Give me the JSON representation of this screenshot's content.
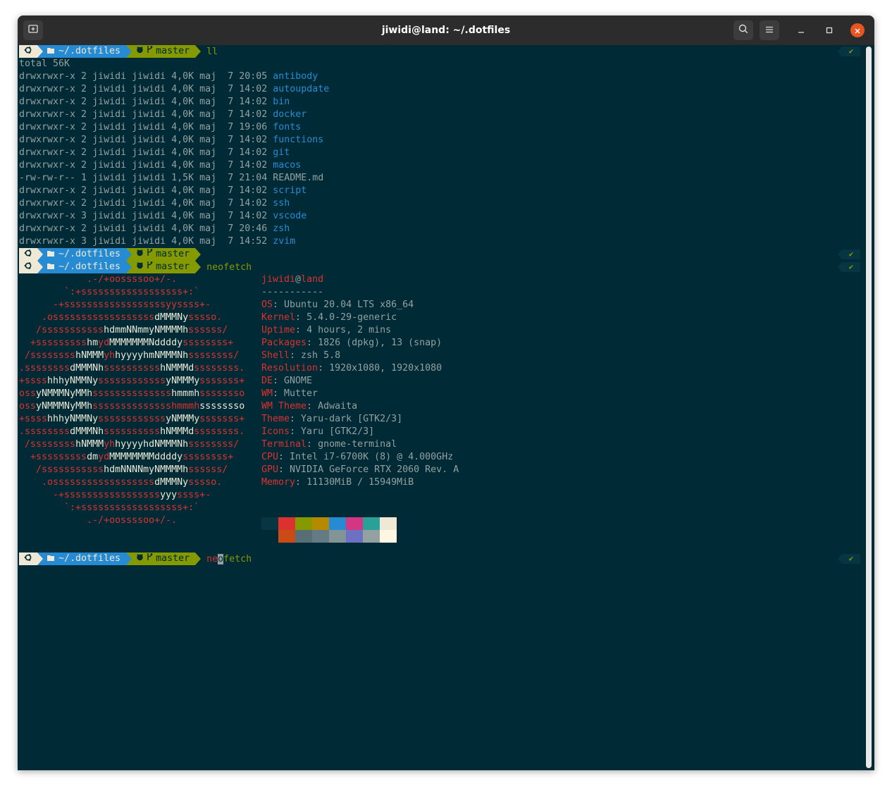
{
  "window": {
    "title": "jiwidi@land: ~/.dotfiles",
    "icons": {
      "new_tab": "new-tab-icon",
      "search": "search-icon",
      "menu": "hamburger-menu-icon",
      "minimize": "minimize-icon",
      "maximize": "maximize-icon",
      "close": "close-icon"
    }
  },
  "prompt": {
    "dir": "~/.dotfiles",
    "branch": "master",
    "status": "✔"
  },
  "commands": {
    "ll": "ll",
    "neofetch": "neofetch",
    "typed_pre": "ne",
    "typed_cursor": "o",
    "typed_post": "fetch"
  },
  "ls": {
    "total": "total 56K",
    "rows": [
      {
        "perm": "drwxrwxr-x 2 jiwidi jiwidi 4,0K maj  7 20:05 ",
        "name": "antibody"
      },
      {
        "perm": "drwxrwxr-x 2 jiwidi jiwidi 4,0K maj  7 14:02 ",
        "name": "autoupdate"
      },
      {
        "perm": "drwxrwxr-x 2 jiwidi jiwidi 4,0K maj  7 14:02 ",
        "name": "bin"
      },
      {
        "perm": "drwxrwxr-x 2 jiwidi jiwidi 4,0K maj  7 14:02 ",
        "name": "docker"
      },
      {
        "perm": "drwxrwxr-x 2 jiwidi jiwidi 4,0K maj  7 19:06 ",
        "name": "fonts"
      },
      {
        "perm": "drwxrwxr-x 2 jiwidi jiwidi 4,0K maj  7 14:02 ",
        "name": "functions"
      },
      {
        "perm": "drwxrwxr-x 2 jiwidi jiwidi 4,0K maj  7 14:02 ",
        "name": "git"
      },
      {
        "perm": "drwxrwxr-x 2 jiwidi jiwidi 4,0K maj  7 14:02 ",
        "name": "macos"
      },
      {
        "perm": "-rw-rw-r-- 1 jiwidi jiwidi 1,5K maj  7 21:04 ",
        "name": "README.md",
        "plain": true
      },
      {
        "perm": "drwxrwxr-x 2 jiwidi jiwidi 4,0K maj  7 14:02 ",
        "name": "script"
      },
      {
        "perm": "drwxrwxr-x 2 jiwidi jiwidi 4,0K maj  7 14:02 ",
        "name": "ssh"
      },
      {
        "perm": "drwxrwxr-x 3 jiwidi jiwidi 4,0K maj  7 14:02 ",
        "name": "vscode"
      },
      {
        "perm": "drwxrwxr-x 2 jiwidi jiwidi 4,0K maj  7 20:46 ",
        "name": "zsh"
      },
      {
        "perm": "drwxrwxr-x 3 jiwidi jiwidi 4,0K maj  7 14:52 ",
        "name": "zvim"
      }
    ]
  },
  "logo": [
    "            .-/+oossssoo+/-.",
    "        `:+ssssssssssssssssss+:`",
    "      -+ssssssssssssssssssyyssss+-",
    "    .ossssssssssssssssss|dMMMNy|sssso.",
    "   /sssssssssss|hdmmNNmmyNMMMMh|ssssss/",
    "  +sssssssss|hm|yd|MMMMMMMNddddy|ssssssss+",
    " /ssssssss|hNMMM|yh|hyyyyhmNMMMNh|ssssssss/",
    ".ssssssss|dMMMNh|ssssssssss|hNMMMd|ssssssss.",
    "+ssss|hhhyNMMNy|ssssssssssss|yNMMMy|sssssss+",
    "oss|yNMMMNyMMh|ssssssssssssss|hmmmh|ssssssso",
    "oss|yNMMMNyMMh|sssssssssssssshmmmh|ssssssso",
    "+ssss|hhhyNMMNy|ssssssssssss|yNMMMy|sssssss+",
    ".ssssssss|dMMMNh|ssssssssss|hNMMMd|ssssssss.",
    " /ssssssss|hNMMM|yh|hyyyyhdNMMMNh|ssssssss/",
    "  +sssssssss|dm|yd|MMMMMMMMddddy|ssssssss+",
    "   /sssssssssss|hdmNNNNmyNMMMMh|ssssss/",
    "    .ossssssssssssssssss|dMMMNy|sssso.",
    "      -+sssssssssssssssss|yyy|ssss+-",
    "        `:+ssssssssssssssssss+:`",
    "            .-/+oossssoo+/-."
  ],
  "info": {
    "user": "jiwidi",
    "at": "@",
    "host": "land",
    "separator": "-----------",
    "rows": [
      {
        "key": "OS",
        "value": "Ubuntu 20.04 LTS x86_64"
      },
      {
        "key": "Kernel",
        "value": "5.4.0-29-generic"
      },
      {
        "key": "Uptime",
        "value": "4 hours, 2 mins"
      },
      {
        "key": "Packages",
        "value": "1826 (dpkg), 13 (snap)"
      },
      {
        "key": "Shell",
        "value": "zsh 5.8"
      },
      {
        "key": "Resolution",
        "value": "1920x1080, 1920x1080"
      },
      {
        "key": "DE",
        "value": "GNOME"
      },
      {
        "key": "WM",
        "value": "Mutter"
      },
      {
        "key": "WM Theme",
        "value": "Adwaita"
      },
      {
        "key": "Theme",
        "value": "Yaru-dark [GTK2/3]"
      },
      {
        "key": "Icons",
        "value": "Yaru [GTK2/3]"
      },
      {
        "key": "Terminal",
        "value": "gnome-terminal"
      },
      {
        "key": "CPU",
        "value": "Intel i7-6700K (8) @ 4.000GHz"
      },
      {
        "key": "GPU",
        "value": "NVIDIA GeForce RTX 2060 Rev. A"
      },
      {
        "key": "Memory",
        "value": "11130MiB / 15949MiB"
      }
    ]
  },
  "palette": {
    "row1": [
      "#073642",
      "#dc322f",
      "#859900",
      "#b58900",
      "#268bd2",
      "#d33682",
      "#2aa198",
      "#eee8d5"
    ],
    "row2": [
      "#002b36",
      "#cb4b16",
      "#586e75",
      "#657b83",
      "#839496",
      "#6c71c4",
      "#93a1a1",
      "#fdf6e3"
    ]
  },
  "colors": {
    "background": "#002b36",
    "foreground": "#93a1a1",
    "blue": "#268bd2",
    "green": "#859900",
    "red": "#dc322f",
    "cream": "#eee8d5",
    "titlebar": "#2c2c2c",
    "close": "#e95420"
  }
}
